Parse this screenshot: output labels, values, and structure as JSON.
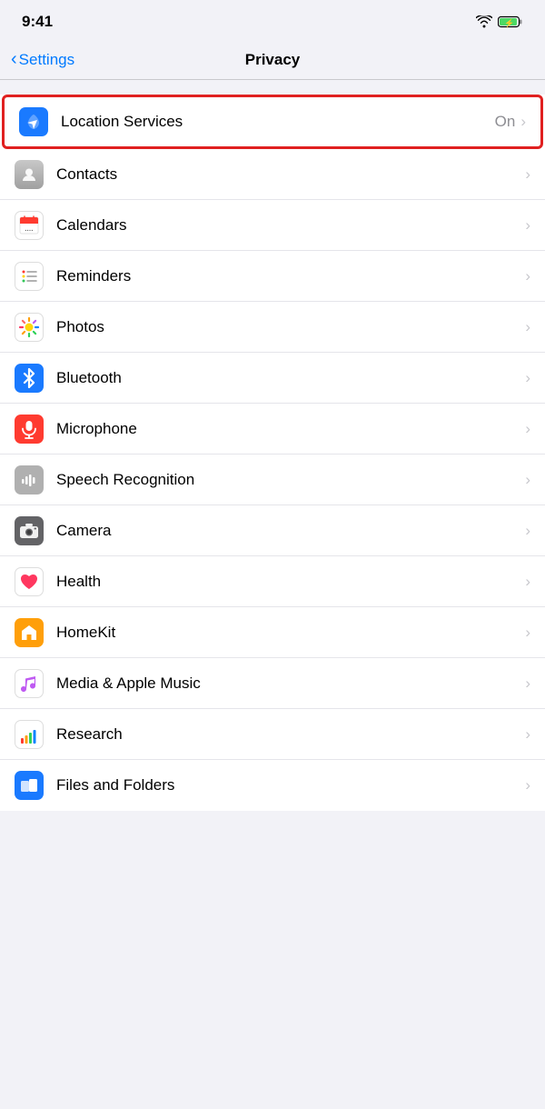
{
  "statusBar": {
    "time": "9:41"
  },
  "navBar": {
    "backLabel": "Settings",
    "title": "Privacy"
  },
  "items": [
    {
      "id": "location-services",
      "label": "Location Services",
      "value": "On",
      "iconType": "location",
      "highlighted": true
    },
    {
      "id": "contacts",
      "label": "Contacts",
      "value": "",
      "iconType": "contacts",
      "highlighted": false
    },
    {
      "id": "calendars",
      "label": "Calendars",
      "value": "",
      "iconType": "calendars",
      "highlighted": false
    },
    {
      "id": "reminders",
      "label": "Reminders",
      "value": "",
      "iconType": "reminders",
      "highlighted": false
    },
    {
      "id": "photos",
      "label": "Photos",
      "value": "",
      "iconType": "photos",
      "highlighted": false
    },
    {
      "id": "bluetooth",
      "label": "Bluetooth",
      "value": "",
      "iconType": "bluetooth",
      "highlighted": false
    },
    {
      "id": "microphone",
      "label": "Microphone",
      "value": "",
      "iconType": "microphone",
      "highlighted": false
    },
    {
      "id": "speech-recognition",
      "label": "Speech Recognition",
      "value": "",
      "iconType": "speech",
      "highlighted": false
    },
    {
      "id": "camera",
      "label": "Camera",
      "value": "",
      "iconType": "camera",
      "highlighted": false
    },
    {
      "id": "health",
      "label": "Health",
      "value": "",
      "iconType": "health",
      "highlighted": false
    },
    {
      "id": "homekit",
      "label": "HomeKit",
      "value": "",
      "iconType": "homekit",
      "highlighted": false
    },
    {
      "id": "media-music",
      "label": "Media & Apple Music",
      "value": "",
      "iconType": "music",
      "highlighted": false
    },
    {
      "id": "research",
      "label": "Research",
      "value": "",
      "iconType": "research",
      "highlighted": false
    },
    {
      "id": "files-folders",
      "label": "Files and Folders",
      "value": "",
      "iconType": "files",
      "highlighted": false
    }
  ]
}
